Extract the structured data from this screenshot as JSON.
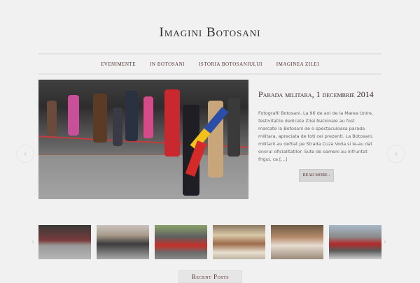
{
  "site": {
    "title": "Imagini Botosani"
  },
  "nav": {
    "items": [
      "Evenimente",
      "In Botosani",
      "Istoria Botosaniului",
      "Imaginea Zilei"
    ]
  },
  "slider": {
    "title": "Parada militara, 1 decembrie 2014",
    "excerpt": "Fotografii Botosani. La 96 de ani de la Marea Unire, festivitatile dedicate Zilei Nationale au fost marcate la Botosani de o spectaculoasa parada militara, apreciata de toti cei prezenti. La Botosani, militarii au defilat pe Strada Cuza Voda si le-au dat onorul oficialitatilor. Sute de oameni au infruntat frigul, ca […]",
    "read_more": "Read more ›",
    "prev_icon": "‹",
    "next_icon": "›"
  },
  "thumbnails": {
    "prev_icon": "‹",
    "next_icon": "›"
  },
  "sections": {
    "recent_posts": "Recent Posts"
  },
  "colors": {
    "background": "#f1f1f1",
    "accent": "#5a3030",
    "flag_red": "#d42a2a",
    "flag_yellow": "#f2c21a",
    "flag_blue": "#2a4ea8"
  }
}
